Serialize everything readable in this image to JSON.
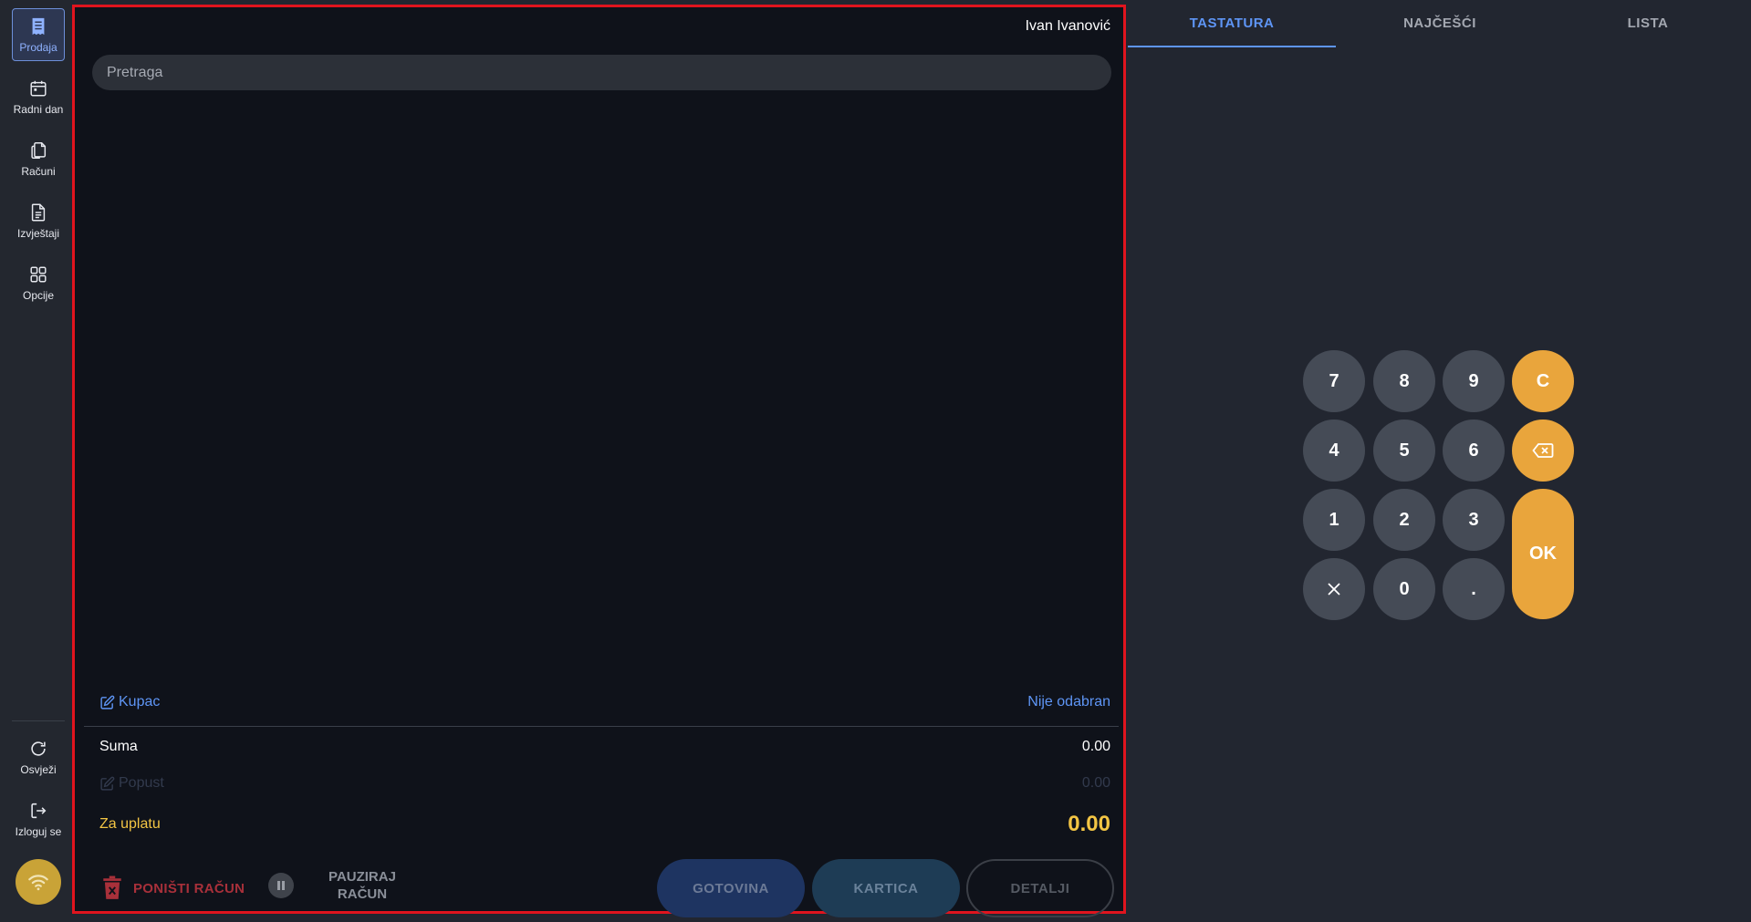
{
  "sidebar": {
    "items": [
      {
        "label": "Prodaja",
        "icon": "receipt-icon"
      },
      {
        "label": "Radni dan",
        "icon": "calendar-icon"
      },
      {
        "label": "Računi",
        "icon": "documents-icon"
      },
      {
        "label": "Izvještaji",
        "icon": "report-icon"
      },
      {
        "label": "Opcije",
        "icon": "grid-icon"
      }
    ],
    "bottom": [
      {
        "label": "Osvježi",
        "icon": "refresh-icon"
      },
      {
        "label": "Izloguj se",
        "icon": "logout-icon"
      }
    ],
    "status_icon": "wifi-icon"
  },
  "main": {
    "user_name": "Ivan Ivanović",
    "search_placeholder": "Pretraga",
    "kupac_label": "Kupac",
    "kupac_value": "Nije odabran",
    "suma_label": "Suma",
    "suma_value": "0.00",
    "popust_label": "Popust",
    "popust_value": "0.00",
    "za_uplatu_label": "Za uplatu",
    "za_uplatu_value": "0.00",
    "ponisti_label": "PONIŠTI RAČUN",
    "pauziraj_label": "PAUZIRAJ\nRAČUN",
    "gotovina_label": "GOTOVINA",
    "kartica_label": "KARTICA",
    "detalji_label": "DETALJI"
  },
  "tabs": [
    {
      "label": "TASTATURA",
      "active": true
    },
    {
      "label": "NAJČEŠĆI",
      "active": false
    },
    {
      "label": "LISTA",
      "active": false
    }
  ],
  "keypad": {
    "k7": "7",
    "k8": "8",
    "k9": "9",
    "clear": "C",
    "k4": "4",
    "k5": "5",
    "k6": "6",
    "k1": "1",
    "k2": "2",
    "k3": "3",
    "ok": "OK",
    "k0": "0",
    "dot": "."
  },
  "colors": {
    "accent": "#5e95f5",
    "highlight": "#f3c544",
    "keypad_orange": "#e9a53c",
    "danger": "#a8303a",
    "frame": "#e0141e"
  }
}
